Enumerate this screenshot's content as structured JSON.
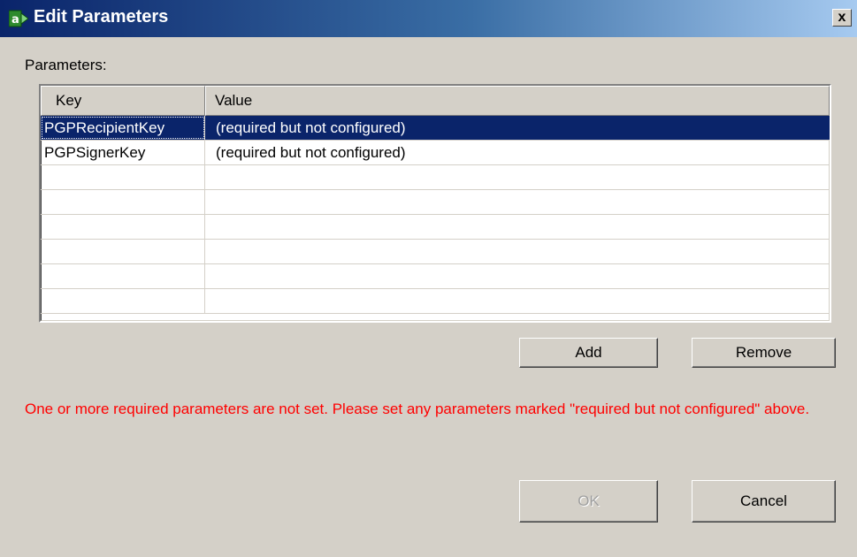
{
  "window": {
    "title": "Edit Parameters",
    "close_label": "x",
    "app_icon": "a-arrow-icon"
  },
  "parameters": {
    "label": "Parameters:",
    "columns": {
      "key": "Key",
      "value": "Value"
    },
    "rows": [
      {
        "key": "PGPRecipientKey",
        "value": "(required but not configured)",
        "selected": true
      },
      {
        "key": "PGPSignerKey",
        "value": "(required but not configured)",
        "selected": false
      },
      {
        "key": "",
        "value": ""
      },
      {
        "key": "",
        "value": ""
      },
      {
        "key": "",
        "value": ""
      },
      {
        "key": "",
        "value": ""
      },
      {
        "key": "",
        "value": ""
      },
      {
        "key": "",
        "value": ""
      }
    ]
  },
  "buttons": {
    "add": "Add",
    "remove": "Remove",
    "ok": "OK",
    "cancel": "Cancel"
  },
  "warning": "One or more required parameters are not set. Please set any parameters marked \"required but not configured\" above.",
  "colors": {
    "selection": "#0a246a",
    "warning_text": "#ff0000",
    "dialog_bg": "#d4d0c8"
  }
}
